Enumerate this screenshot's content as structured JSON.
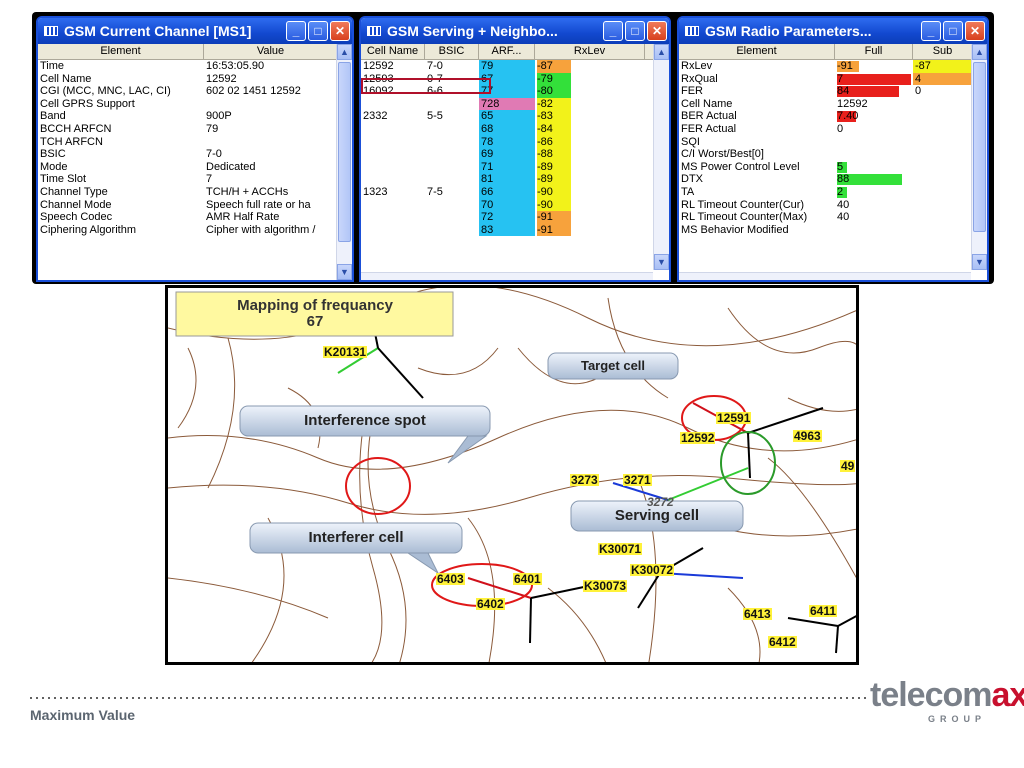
{
  "window1": {
    "title": "GSM Current Channel [MS1]",
    "col_element": "Element",
    "col_value": "Value",
    "rows": [
      {
        "e": "Time",
        "v": "16:53:05.90"
      },
      {
        "e": "Cell Name",
        "v": "12592"
      },
      {
        "e": "CGI (MCC, MNC, LAC, CI)",
        "v": "602 02 1451 12592"
      },
      {
        "e": "Cell GPRS Support",
        "v": ""
      },
      {
        "e": "Band",
        "v": "900P"
      },
      {
        "e": "BCCH ARFCN",
        "v": "79"
      },
      {
        "e": "TCH ARFCN",
        "v": ""
      },
      {
        "e": "BSIC",
        "v": "7-0"
      },
      {
        "e": "Mode",
        "v": "Dedicated"
      },
      {
        "e": "Time Slot",
        "v": "7"
      },
      {
        "e": "Channel Type",
        "v": "TCH/H + ACCHs"
      },
      {
        "e": "Channel Mode",
        "v": "Speech full rate or ha"
      },
      {
        "e": "Speech Codec",
        "v": "AMR Half Rate"
      },
      {
        "e": "Ciphering Algorithm",
        "v": "Cipher with algorithm /"
      }
    ]
  },
  "window2": {
    "title": "GSM Serving + Neighbo...",
    "col_cell": "Cell Name",
    "col_bsic": "BSIC",
    "col_arfcn": "ARF...",
    "col_rxlev": "RxLev",
    "rows": [
      {
        "c": "12592",
        "b": "7-0",
        "a": "79",
        "r": "-87",
        "rc": "#f7a23c"
      },
      {
        "c": "12593",
        "b": "0-7",
        "a": "67",
        "r": "-79",
        "rc": "#33e03a"
      },
      {
        "c": "16092",
        "b": "6-6",
        "a": "77",
        "r": "-80",
        "rc": "#33e03a"
      },
      {
        "c": "",
        "b": "",
        "a": "728",
        "r": "-82",
        "rc": "#f2f21a",
        "ac": "#e07ab4"
      },
      {
        "c": "2332",
        "b": "5-5",
        "a": "65",
        "r": "-83",
        "rc": "#f2f21a"
      },
      {
        "c": "",
        "b": "",
        "a": "68",
        "r": "-84",
        "rc": "#f2f21a"
      },
      {
        "c": "",
        "b": "",
        "a": "78",
        "r": "-86",
        "rc": "#f2f21a"
      },
      {
        "c": "",
        "b": "",
        "a": "69",
        "r": "-88",
        "rc": "#f2f21a"
      },
      {
        "c": "",
        "b": "",
        "a": "71",
        "r": "-89",
        "rc": "#f2f21a"
      },
      {
        "c": "",
        "b": "",
        "a": "81",
        "r": "-89",
        "rc": "#f2f21a"
      },
      {
        "c": "1323",
        "b": "7-5",
        "a": "66",
        "r": "-90",
        "rc": "#f2f21a"
      },
      {
        "c": "",
        "b": "",
        "a": "70",
        "r": "-90",
        "rc": "#f2f21a"
      },
      {
        "c": "",
        "b": "",
        "a": "72",
        "r": "-91",
        "rc": "#f7a23c"
      },
      {
        "c": "",
        "b": "",
        "a": "83",
        "r": "-91",
        "rc": "#f7a23c"
      }
    ]
  },
  "window3": {
    "title": "GSM Radio Parameters...",
    "col_element": "Element",
    "col_full": "Full",
    "col_sub": "Sub",
    "rows": [
      {
        "e": "RxLev",
        "f": "-91",
        "fc": "#f7a23c",
        "fw": 0.3,
        "s": "-87",
        "sc": "#f2f21a"
      },
      {
        "e": "RxQual",
        "f": "7",
        "fc": "#e8201c",
        "fw": 1.0,
        "s": "4",
        "sc": "#f7a23c"
      },
      {
        "e": "FER",
        "f": "84",
        "fc": "#e8201c",
        "fw": 0.84,
        "s": "0",
        "sc": ""
      },
      {
        "e": "Cell Name",
        "f": "12592",
        "fc": "",
        "fw": 0,
        "s": "",
        "sc": ""
      },
      {
        "e": "BER Actual",
        "f": "7.40",
        "fc": "#e8201c",
        "fw": 0.25,
        "s": "",
        "sc": ""
      },
      {
        "e": "FER Actual",
        "f": "0",
        "fc": "",
        "fw": 0,
        "s": "",
        "sc": ""
      },
      {
        "e": "SQI",
        "f": "",
        "fc": "",
        "fw": 0,
        "s": "",
        "sc": ""
      },
      {
        "e": "C/I Worst/Best[0]",
        "f": "",
        "fc": "",
        "fw": 0,
        "s": "",
        "sc": ""
      },
      {
        "e": "MS Power Control Level",
        "f": "5",
        "fc": "#33e03a",
        "fw": 0.12,
        "s": "",
        "sc": ""
      },
      {
        "e": "DTX",
        "f": "88",
        "fc": "#33e03a",
        "fw": 0.88,
        "s": "",
        "sc": ""
      },
      {
        "e": "TA",
        "f": "2",
        "fc": "#33e03a",
        "fw": 0.06,
        "s": "",
        "sc": ""
      },
      {
        "e": "RL Timeout Counter(Cur)",
        "f": "40",
        "fc": "",
        "fw": 0,
        "s": "",
        "sc": ""
      },
      {
        "e": "RL Timeout Counter(Max)",
        "f": "40",
        "fc": "",
        "fw": 0,
        "s": "",
        "sc": ""
      },
      {
        "e": "MS Behavior Modified",
        "f": "",
        "fc": "",
        "fw": 0,
        "s": "",
        "sc": ""
      }
    ]
  },
  "map": {
    "note": "Mapping of frequancy 67",
    "note_line1": "Mapping of frequancy",
    "note_line2": "67",
    "callouts": {
      "target": "Target cell",
      "interference": "Interference spot",
      "interferer": "Interferer cell",
      "serving": "Serving cell"
    },
    "labels": {
      "k20131": "K20131",
      "c12591": "12591",
      "c12592": "12592",
      "c4963": "4963",
      "c49": "49",
      "c3273": "3273",
      "c3271": "3271",
      "c3272": "3272",
      "k30071": "K30071",
      "k30072": "K30072",
      "k30073": "K30073",
      "c6403": "6403",
      "c6401": "6401",
      "c6402": "6402",
      "c6413": "6413",
      "c6411": "6411",
      "c6412": "6412"
    }
  },
  "footer": {
    "text": "Maximum Value",
    "logo_main": "telecom",
    "logo_accent": "ax",
    "logo_sub": "GROUP"
  }
}
